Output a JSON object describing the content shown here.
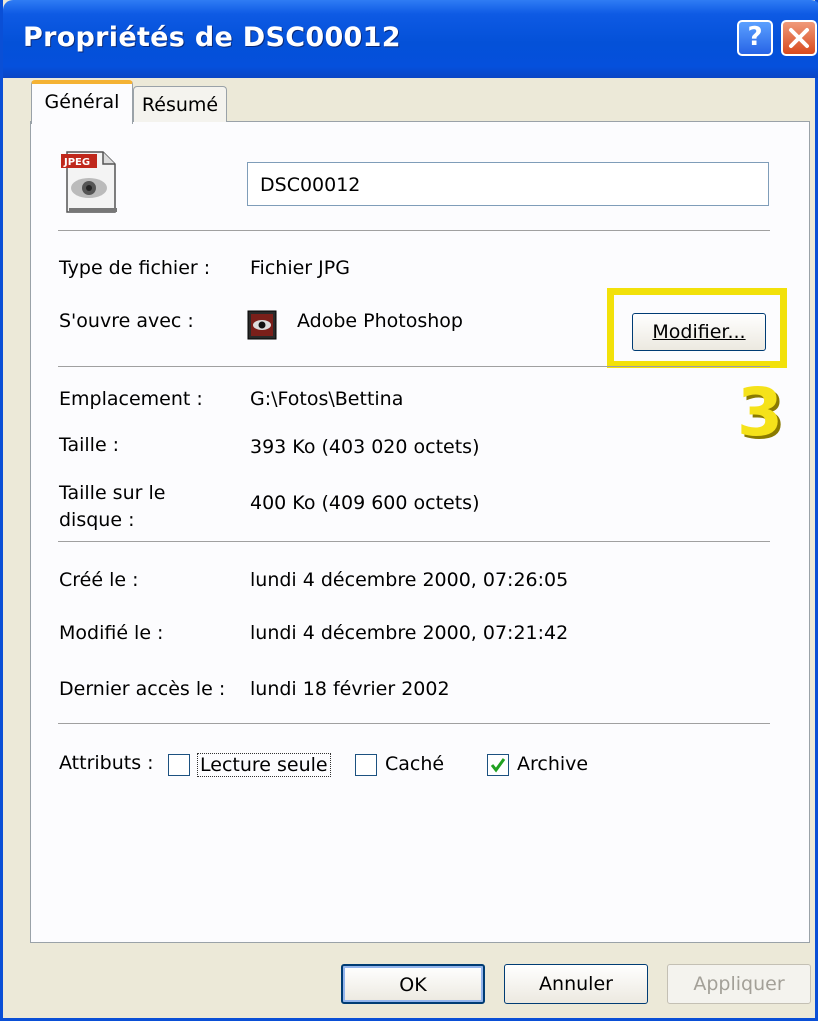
{
  "window": {
    "title": "Propriétés de DSC00012",
    "help_label": "?",
    "close_label": "✕"
  },
  "tabs": [
    {
      "label": "Général",
      "active": true
    },
    {
      "label": "Résumé",
      "active": false
    }
  ],
  "general": {
    "file_name": "DSC00012",
    "file_icon": "jpeg-file-icon",
    "file_type_label": "Type de fichier :",
    "file_type_value": "Fichier JPG",
    "opens_with_label": "S'ouvre avec :",
    "opens_with_value": "Adobe Photoshop",
    "opens_with_icon": "photoshop-icon",
    "modify_button": "Modifier...",
    "location_label": "Emplacement :",
    "location_value": "G:\\Fotos\\Bettina",
    "size_label": "Taille :",
    "size_value": "393 Ko (403 020 octets)",
    "size_on_disk_label_line1": "Taille sur le",
    "size_on_disk_label_line2": "disque :",
    "size_on_disk_value": "400 Ko (409 600 octets)",
    "created_label": "Créé le :",
    "created_value": "lundi 4 décembre 2000, 07:26:05",
    "modified_label": "Modifié le :",
    "modified_value": "lundi 4 décembre 2000, 07:21:42",
    "accessed_label": "Dernier accès le :",
    "accessed_value": "lundi 18 février 2002",
    "attributes_label": "Attributs :",
    "attributes": [
      {
        "label": "Lecture seule",
        "checked": false
      },
      {
        "label": "Caché",
        "checked": false
      },
      {
        "label": "Archive",
        "checked": true
      }
    ]
  },
  "annotation": {
    "step_number": "3",
    "highlight_color": "#f2e10a"
  },
  "footer": {
    "ok": "OK",
    "cancel": "Annuler",
    "apply": "Appliquer"
  },
  "colors": {
    "titlebar": "#0451d8",
    "tab_accent": "#f4b234",
    "checkmark": "#21a121"
  }
}
